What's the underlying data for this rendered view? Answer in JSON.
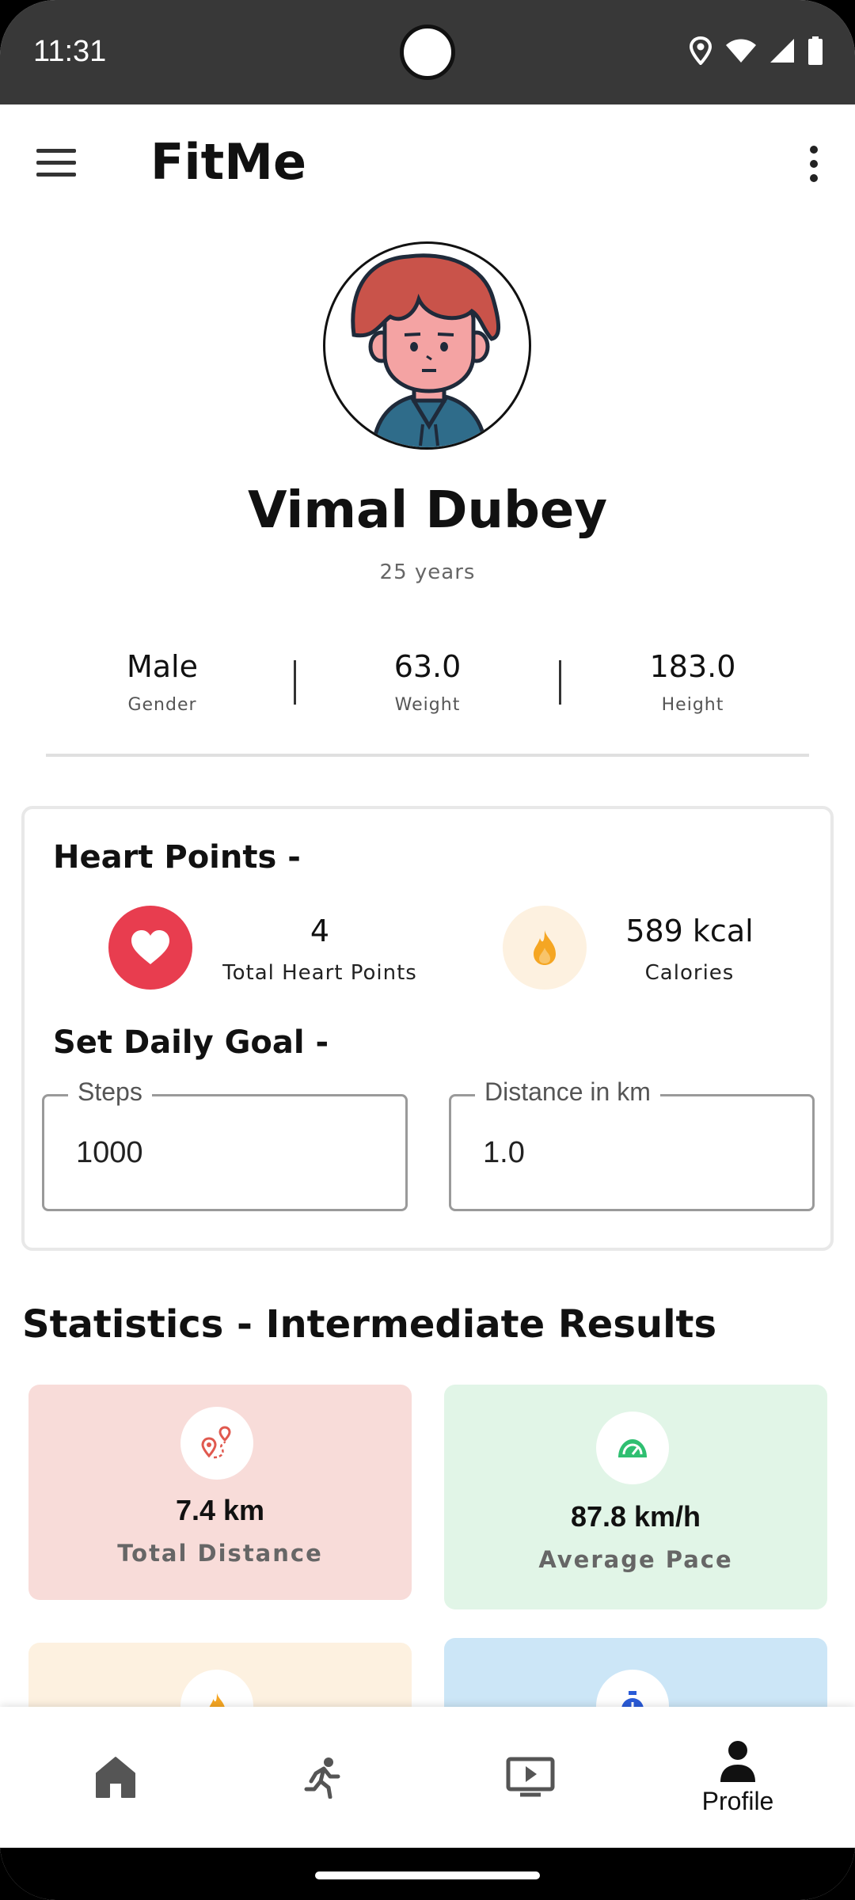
{
  "status_bar": {
    "time": "11:31"
  },
  "app_bar": {
    "title": "FitMe"
  },
  "profile": {
    "name": "Vimal Dubey",
    "age": "25 years"
  },
  "metrics": [
    {
      "value": "Male",
      "label": "Gender"
    },
    {
      "value": "63.0",
      "label": "Weight"
    },
    {
      "value": "183.0",
      "label": "Height"
    }
  ],
  "heart_card": {
    "title": "Heart Points -",
    "heart_points": {
      "value": "4",
      "label": "Total Heart Points"
    },
    "calories": {
      "value": "589 kcal",
      "label": "Calories"
    },
    "goal_title": "Set Daily Goal -",
    "steps_field": {
      "label": "Steps",
      "value": "1000"
    },
    "distance_field": {
      "label": "Distance in km",
      "value": "1.0"
    }
  },
  "statistics": {
    "title": "Statistics - Intermediate Results",
    "cards": [
      {
        "value": "7.4 km",
        "label": "Total Distance",
        "bg": "#f8dcd9",
        "icon": "route-pin-icon"
      },
      {
        "value": "87.8 km/h",
        "label": "Average Pace",
        "bg": "#e1f5e7",
        "icon": "speedometer-icon"
      },
      {
        "bg": "#fdf1e0",
        "icon": "fire-icon"
      },
      {
        "bg": "#cce6f7",
        "icon": "stopwatch-icon"
      }
    ]
  },
  "bottom_nav": {
    "items": [
      {
        "icon": "home-icon"
      },
      {
        "icon": "run-icon"
      },
      {
        "icon": "video-icon"
      },
      {
        "icon": "person-icon",
        "label": "Profile"
      }
    ]
  },
  "colors": {
    "heart": "#e83d4f",
    "calories_bg": "#fdf1e0",
    "calories_icon": "#f5a623",
    "status_bar": "#383838"
  }
}
